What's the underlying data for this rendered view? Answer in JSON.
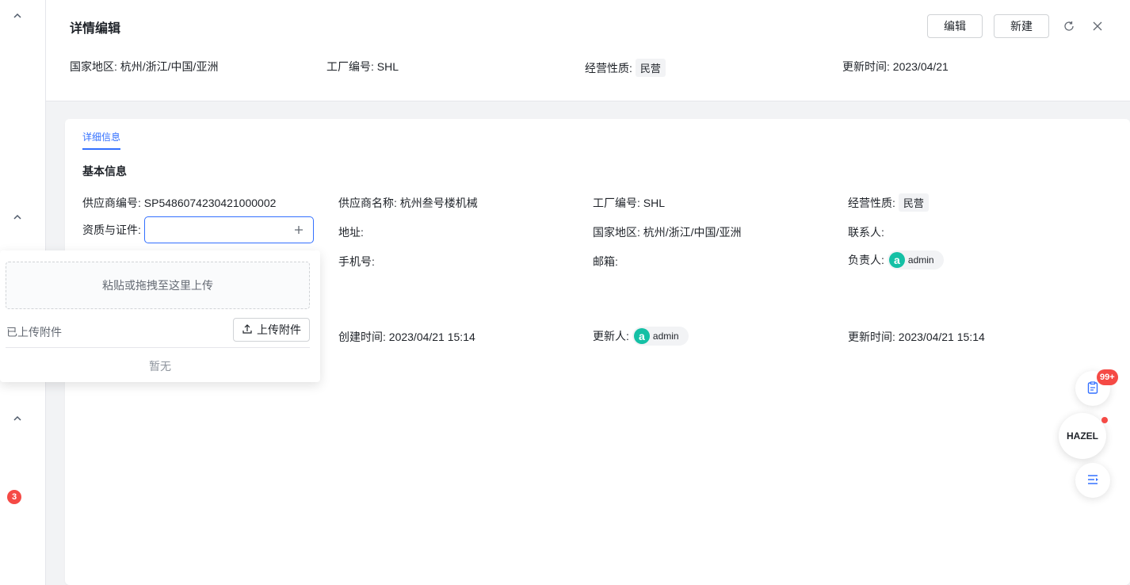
{
  "header": {
    "title": "详情编辑",
    "edit_label": "编辑",
    "new_label": "新建",
    "meta": {
      "region": "国家地区: 杭州/浙江/中国/亚洲",
      "factory_no": "工厂编号: SHL",
      "biz_nature_label": "经营性质:",
      "biz_nature_value": "民营",
      "updated_at": "更新时间: 2023/04/21"
    }
  },
  "tabs": [
    "详细信息"
  ],
  "section_title": "基本信息",
  "fields": {
    "supplier_no": "供应商编号: SP5486074230421000002",
    "supplier_name": "供应商名称: 杭州叁号楼机械",
    "factory_no": "工厂编号: SHL",
    "biz_nature_label": "经营性质:",
    "biz_nature_value": "民营",
    "certs_label": "资质与证件:",
    "address": "地址:",
    "region": "国家地区: 杭州/浙江/中国/亚洲",
    "contact": "联系人:",
    "mobile": "手机号:",
    "email": "邮箱:",
    "owner_label": "负责人:",
    "owner_name": "admin",
    "created_at": "创建时间: 2023/04/21 15:14",
    "updater_label": "更新人:",
    "updater_name": "admin",
    "updated_at": "更新时间: 2023/04/21 15:14",
    "avatar_letter": "a"
  },
  "upload_popover": {
    "dropzone_text": "粘贴或拖拽至这里上传",
    "uploaded_label": "已上传附件",
    "upload_button": "上传附件",
    "empty_text": "暂无"
  },
  "left_rail": {
    "badge_count": "3"
  },
  "floating": {
    "badge": "99+",
    "assistant_label": "HAZEL"
  },
  "colors": {
    "accent": "#3370ff",
    "avatar": "#14c0a5",
    "badge": "#f54a45"
  }
}
